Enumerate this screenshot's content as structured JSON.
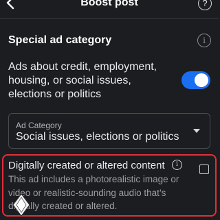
{
  "header": {
    "title": "Boost post",
    "back_icon": "chevron-left-icon",
    "help_icon": "question-circle-icon",
    "help_glyph": "?"
  },
  "special_ad_category": {
    "title": "Special ad category",
    "info_icon": "info-circle-icon",
    "info_glyph": "i",
    "toggle_label": "Ads about credit, employment, housing, or social issues, elections or politics",
    "toggle_on": true,
    "accent_color": "#1a6ef0"
  },
  "ad_category_select": {
    "label": "Ad Category",
    "value": "Social issues, elections or politics",
    "caret_icon": "caret-down-icon"
  },
  "digital_content": {
    "title": "Digitally created or altered content",
    "info_glyph": "i",
    "description": "This ad includes a photorealistic image or video or realistic-sounding audio that’s digitally created or altered.",
    "checked": false,
    "highlight_color": "#e0303a"
  }
}
